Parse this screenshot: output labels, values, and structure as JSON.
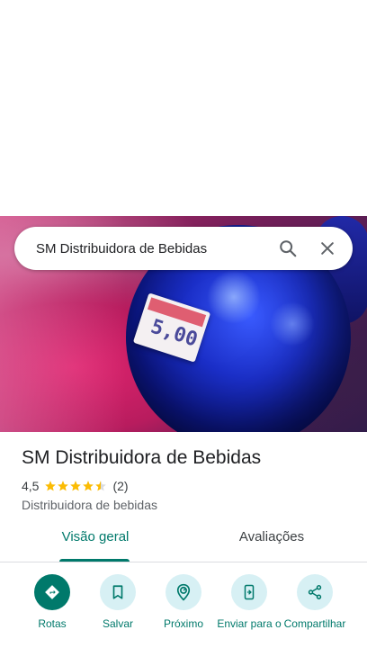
{
  "search": {
    "query": "SM Distribuidora de Bebidas"
  },
  "photo": {
    "price_tag_text": "5,00"
  },
  "place": {
    "name": "SM Distribuidora de Bebidas",
    "rating": "4,5",
    "rating_value": 4.5,
    "review_count": "(2)",
    "category": "Distribuidora de bebidas"
  },
  "tabs": [
    {
      "label": "Visão geral",
      "selected": true
    },
    {
      "label": "Avaliações",
      "selected": false
    }
  ],
  "actions": [
    {
      "label": "Rotas",
      "icon": "directions-icon"
    },
    {
      "label": "Salvar",
      "icon": "bookmark-icon"
    },
    {
      "label": "Próximo",
      "icon": "nearby-icon"
    },
    {
      "label": "Enviar para o",
      "icon": "send-to-phone-icon"
    },
    {
      "label": "Compartilhar",
      "icon": "share-icon"
    }
  ],
  "colors": {
    "accent": "#00796b",
    "star": "#fbbc04",
    "chip_bg": "#d7f0f4"
  }
}
